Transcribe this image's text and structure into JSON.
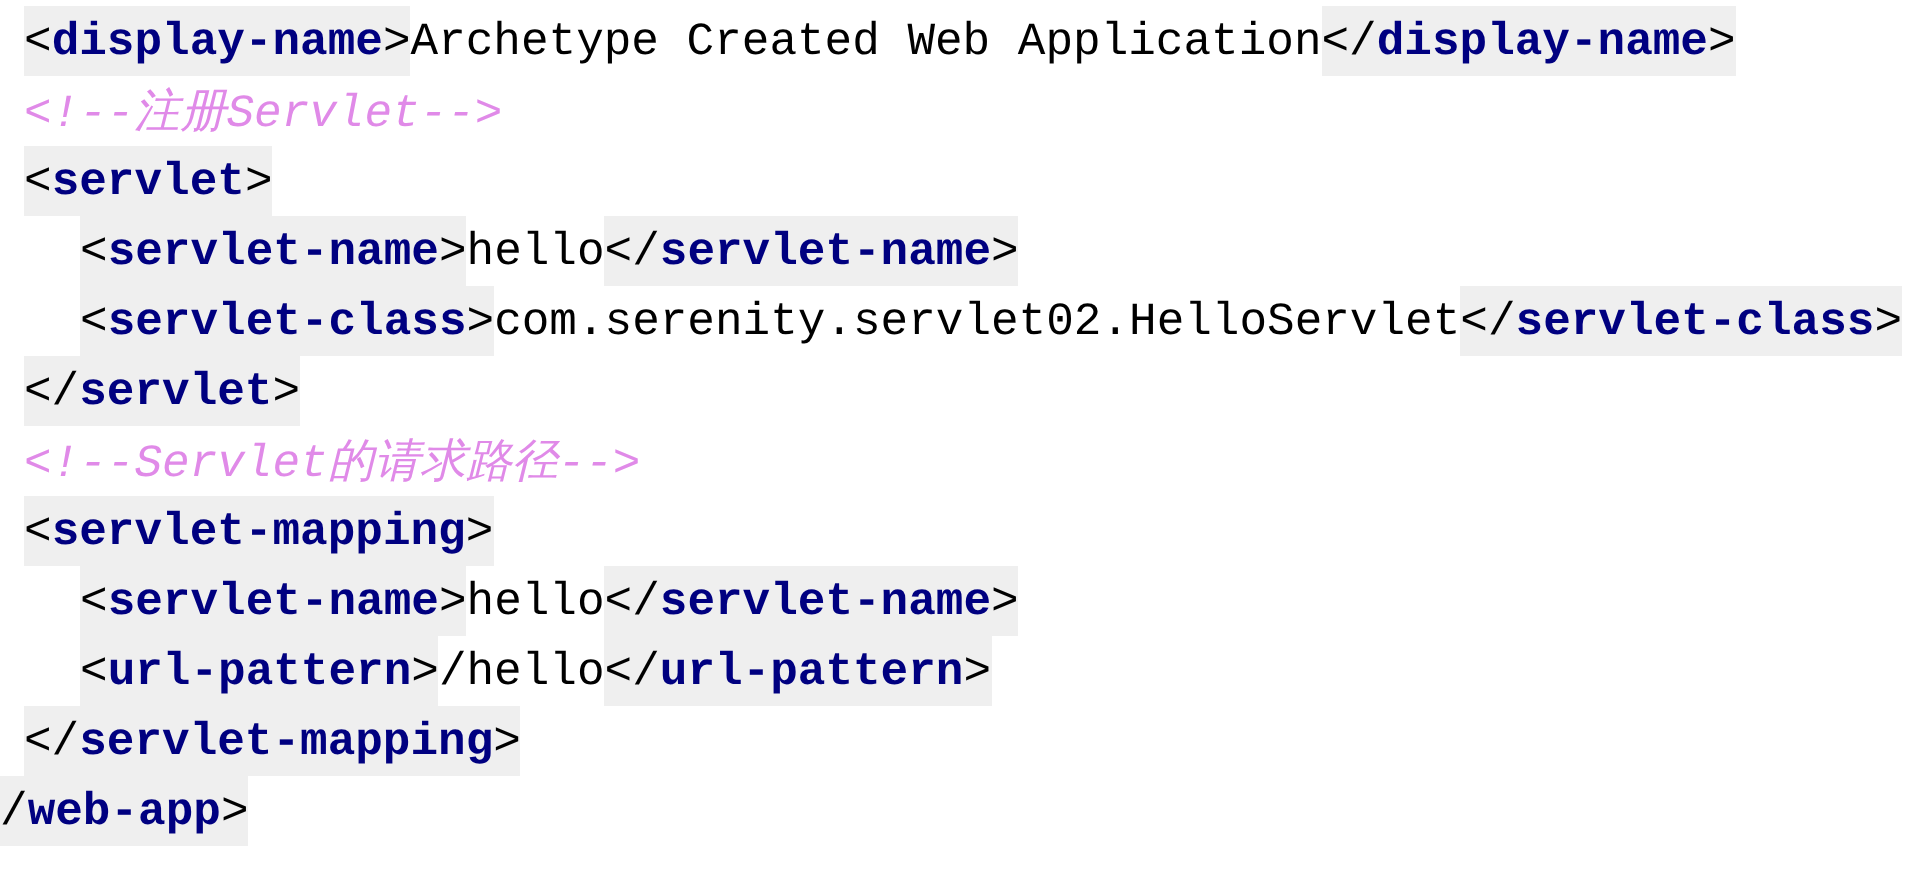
{
  "lines": [
    {
      "children": [
        {
          "tokens": [
            {
              "kind": "tag",
              "parts": [
                {
                  "kind": "punct",
                  "text": "<"
                },
                {
                  "kind": "name",
                  "text": "display-name"
                },
                {
                  "kind": "punct",
                  "text": ">"
                }
              ]
            },
            {
              "kind": "text",
              "text": "Archetype Created Web Application"
            },
            {
              "kind": "tag",
              "parts": [
                {
                  "kind": "punct",
                  "text": "</"
                },
                {
                  "kind": "name",
                  "text": "display-name"
                },
                {
                  "kind": "punct",
                  "text": ">"
                }
              ]
            }
          ]
        },
        {
          "tokens": [
            {
              "kind": "comment",
              "text": "<!--注册Servlet-->"
            }
          ]
        },
        {
          "tokens": [
            {
              "kind": "tag",
              "parts": [
                {
                  "kind": "punct",
                  "text": "<"
                },
                {
                  "kind": "name",
                  "text": "servlet"
                },
                {
                  "kind": "punct",
                  "text": ">"
                }
              ]
            }
          ],
          "children": [
            {
              "tokens": [
                {
                  "kind": "tag",
                  "parts": [
                    {
                      "kind": "punct",
                      "text": "<"
                    },
                    {
                      "kind": "name",
                      "text": "servlet-name"
                    },
                    {
                      "kind": "punct",
                      "text": ">"
                    }
                  ]
                },
                {
                  "kind": "text",
                  "text": "hello"
                },
                {
                  "kind": "tag",
                  "parts": [
                    {
                      "kind": "punct",
                      "text": "</"
                    },
                    {
                      "kind": "name",
                      "text": "servlet-name"
                    },
                    {
                      "kind": "punct",
                      "text": ">"
                    }
                  ]
                }
              ]
            },
            {
              "tokens": [
                {
                  "kind": "tag",
                  "parts": [
                    {
                      "kind": "punct",
                      "text": "<"
                    },
                    {
                      "kind": "name",
                      "text": "servlet-class"
                    },
                    {
                      "kind": "punct",
                      "text": ">"
                    }
                  ]
                },
                {
                  "kind": "text",
                  "text": "com.serenity.servlet02.HelloServlet"
                },
                {
                  "kind": "tag",
                  "parts": [
                    {
                      "kind": "punct",
                      "text": "</"
                    },
                    {
                      "kind": "name",
                      "text": "servlet-class"
                    },
                    {
                      "kind": "punct",
                      "text": ">"
                    }
                  ]
                }
              ]
            }
          ]
        },
        {
          "tokens": [
            {
              "kind": "tag",
              "parts": [
                {
                  "kind": "punct",
                  "text": "</"
                },
                {
                  "kind": "name",
                  "text": "servlet"
                },
                {
                  "kind": "punct",
                  "text": ">"
                }
              ]
            }
          ]
        },
        {
          "tokens": [
            {
              "kind": "comment",
              "text": "<!--Servlet的请求路径-->"
            }
          ]
        },
        {
          "tokens": [
            {
              "kind": "tag",
              "parts": [
                {
                  "kind": "punct",
                  "text": "<"
                },
                {
                  "kind": "name",
                  "text": "servlet-mapping"
                },
                {
                  "kind": "punct",
                  "text": ">"
                }
              ]
            }
          ],
          "children": [
            {
              "tokens": [
                {
                  "kind": "tag",
                  "parts": [
                    {
                      "kind": "punct",
                      "text": "<"
                    },
                    {
                      "kind": "name",
                      "text": "servlet-name"
                    },
                    {
                      "kind": "punct",
                      "text": ">"
                    }
                  ]
                },
                {
                  "kind": "text",
                  "text": "hello"
                },
                {
                  "kind": "tag",
                  "parts": [
                    {
                      "kind": "punct",
                      "text": "</"
                    },
                    {
                      "kind": "name",
                      "text": "servlet-name"
                    },
                    {
                      "kind": "punct",
                      "text": ">"
                    }
                  ]
                }
              ]
            },
            {
              "tokens": [
                {
                  "kind": "tag",
                  "parts": [
                    {
                      "kind": "punct",
                      "text": "<"
                    },
                    {
                      "kind": "name",
                      "text": "url-pattern"
                    },
                    {
                      "kind": "punct",
                      "text": ">"
                    }
                  ]
                },
                {
                  "kind": "text",
                  "text": "/hello"
                },
                {
                  "kind": "tag",
                  "parts": [
                    {
                      "kind": "punct",
                      "text": "</"
                    },
                    {
                      "kind": "name",
                      "text": "url-pattern"
                    },
                    {
                      "kind": "punct",
                      "text": ">"
                    }
                  ]
                }
              ]
            }
          ]
        },
        {
          "tokens": [
            {
              "kind": "tag",
              "parts": [
                {
                  "kind": "punct",
                  "text": "</"
                },
                {
                  "kind": "name",
                  "text": "servlet-mapping"
                },
                {
                  "kind": "punct",
                  "text": ">"
                }
              ]
            }
          ]
        }
      ]
    },
    {
      "tokens": [
        {
          "kind": "tag",
          "parts": [
            {
              "kind": "punct",
              "text": "/"
            },
            {
              "kind": "name",
              "text": "web-app"
            },
            {
              "kind": "punct",
              "text": ">"
            }
          ]
        }
      ]
    }
  ]
}
